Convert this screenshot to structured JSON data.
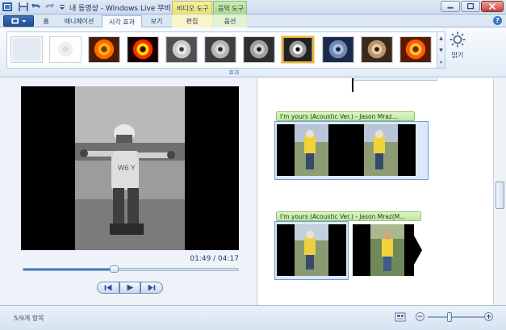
{
  "window": {
    "title": "내 동영상 - Windows Live 무비 메이커",
    "context_tabs": {
      "video_tools": "비디오 도구",
      "music_tools": "음악 도구"
    }
  },
  "quick_access": [
    "save-icon",
    "undo-icon",
    "redo-icon",
    "customize-arrow-icon"
  ],
  "ribbon": {
    "app_button_icon": "app-menu-icon",
    "tabs": [
      {
        "label": "홈",
        "active": false
      },
      {
        "label": "애니메이션",
        "active": false
      },
      {
        "label": "시각 효과",
        "active": true
      },
      {
        "label": "보기",
        "active": false
      },
      {
        "label": "편집",
        "active": false,
        "context": "video"
      },
      {
        "label": "옵션",
        "active": false,
        "context": "music"
      }
    ],
    "effects_group_label": "효과",
    "effects": [
      {
        "name": "no-effect",
        "selected": false
      },
      {
        "name": "soft-focus",
        "selected": false
      },
      {
        "name": "warm-color",
        "selected": false
      },
      {
        "name": "saturated",
        "selected": false
      },
      {
        "name": "grayscale-1",
        "selected": false
      },
      {
        "name": "grayscale-2",
        "selected": false
      },
      {
        "name": "grayscale-3",
        "selected": false
      },
      {
        "name": "black-and-white",
        "selected": true
      },
      {
        "name": "cyan-tone",
        "selected": false
      },
      {
        "name": "sepia-tone",
        "selected": false
      },
      {
        "name": "edge-detect",
        "selected": false
      }
    ],
    "brightness_label": "밝기",
    "brightness_icon": "brightness-sun-icon"
  },
  "preview": {
    "timecode": "01:49 / 04:17",
    "progress": 0.42,
    "controls": [
      "previous-frame-icon",
      "play-icon",
      "next-frame-icon"
    ]
  },
  "storyboard": {
    "clips": [
      {
        "audio_label": "I'm yours (Acoustic Ver.) - Jason Mraz...",
        "frames": 2
      },
      {
        "audio_label": "I'm yours (Acoustic Ver.) - Jason Mraz(M...",
        "frames": 2
      }
    ]
  },
  "status": {
    "count": "5/9개 항목",
    "zoom_level": 0.38
  },
  "colors": {
    "accent": "#3b78c8",
    "video_tools": "#f3ec98",
    "music_tools": "#bde6a0",
    "selection": "#e8b23d"
  }
}
